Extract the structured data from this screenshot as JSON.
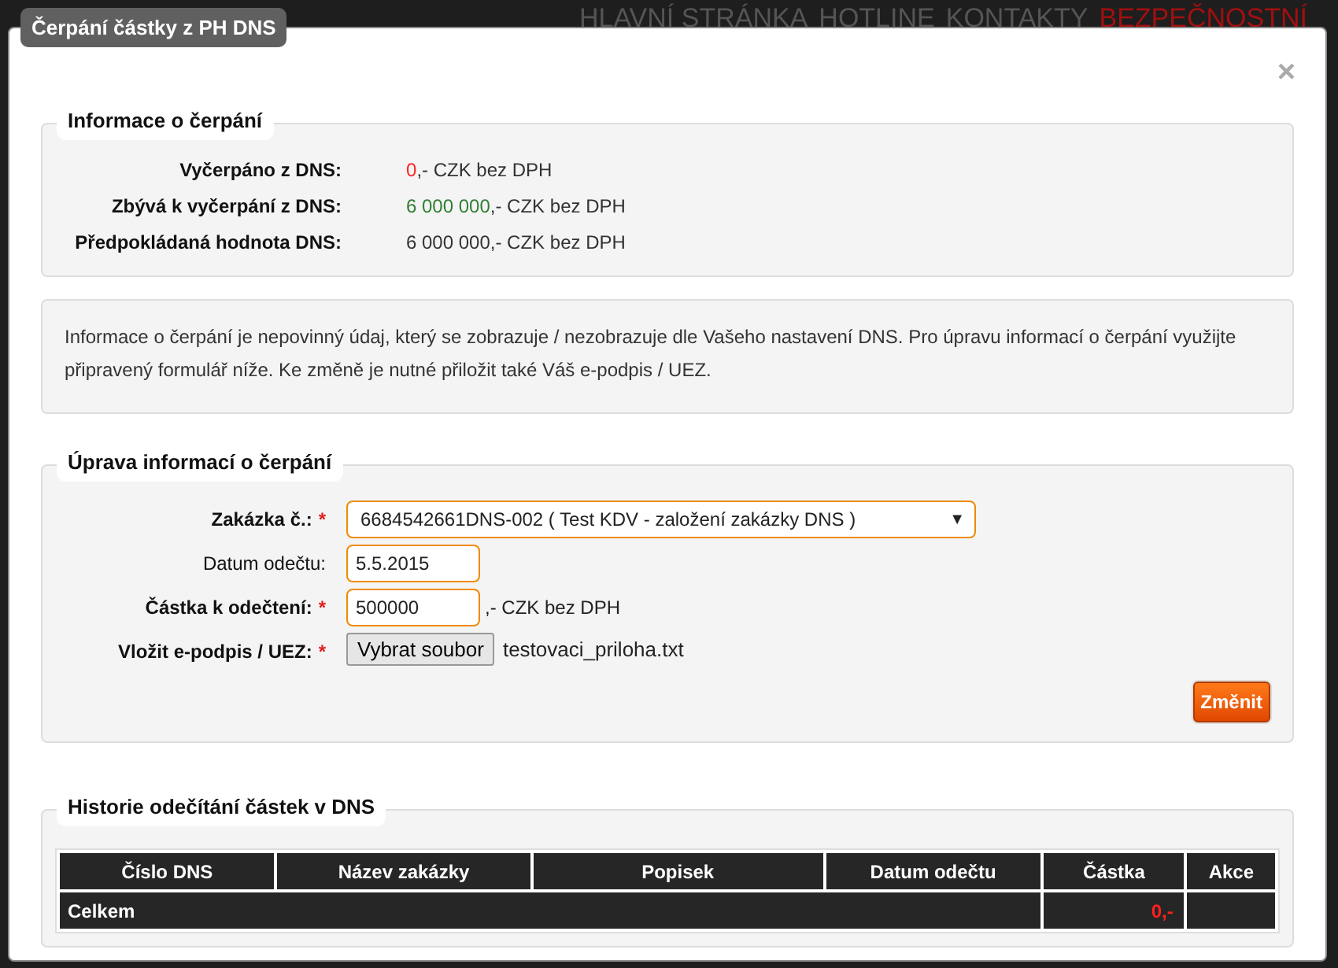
{
  "site_nav": [
    {
      "label": "HLAVNÍ STRÁNKA",
      "color": "#555555"
    },
    {
      "label": "HOTLINE",
      "color": "#555555"
    },
    {
      "label": "KONTAKTY",
      "color": "#555555"
    },
    {
      "label": "BEZPEČNOSTNÍ",
      "color": "#a01010"
    }
  ],
  "dialog": {
    "title": "Čerpání částky z PH DNS",
    "close": "×"
  },
  "summary": {
    "title": "Informace o čerpání",
    "rows": [
      {
        "label": "Vyčerpáno z DNS:",
        "amount": "0",
        "suffix": ",- CZK bez DPH",
        "color": "#ff2020"
      },
      {
        "label": "Zbývá k vyčerpání z DNS:",
        "amount": "6 000 000",
        "suffix": ",- CZK bez DPH",
        "color": "#2e7d32"
      },
      {
        "label": "Předpokládaná hodnota DNS:",
        "amount": "6 000 000",
        "suffix": ",- CZK bez DPH",
        "color": "#333333"
      }
    ]
  },
  "notice": "Informace o čerpání je nepovinný údaj, který se zobrazuje / nezobrazuje dle Vašeho nastavení DNS. Pro úpravu informací o čerpání využijte připravený formulář níže. Ke změně je nutné přiložit také Váš e-podpis / UEZ.",
  "form": {
    "title": "Úprava informací o čerpání",
    "fields": [
      {
        "kind": "select",
        "label": "Zakázka č.:",
        "required": true,
        "required_mark": "*",
        "value": "6684542661DNS-002 ( Test KDV - založení zakázky DNS )",
        "caret": "▼"
      },
      {
        "kind": "input",
        "label": "Datum odečtu:",
        "required": false,
        "value": "5.5.2015"
      },
      {
        "kind": "input",
        "label": "Částka k odečtení:",
        "required": true,
        "required_mark": "*",
        "value": "500000",
        "suffix": ",- CZK bez DPH"
      },
      {
        "kind": "file",
        "label": "Vložit e-podpis / UEZ:",
        "required": true,
        "required_mark": "*",
        "button": "Vybrat soubor",
        "file_name": "testovaci_priloha.txt"
      }
    ],
    "submit": "Změnit"
  },
  "history": {
    "title": "Historie odečítání částek v DNS",
    "columns": [
      "Číslo DNS",
      "Název zakázky",
      "Popisek",
      "Datum odečtu",
      "Částka",
      "Akce"
    ],
    "total": {
      "label": "Celkem",
      "amount": "0,-"
    }
  }
}
